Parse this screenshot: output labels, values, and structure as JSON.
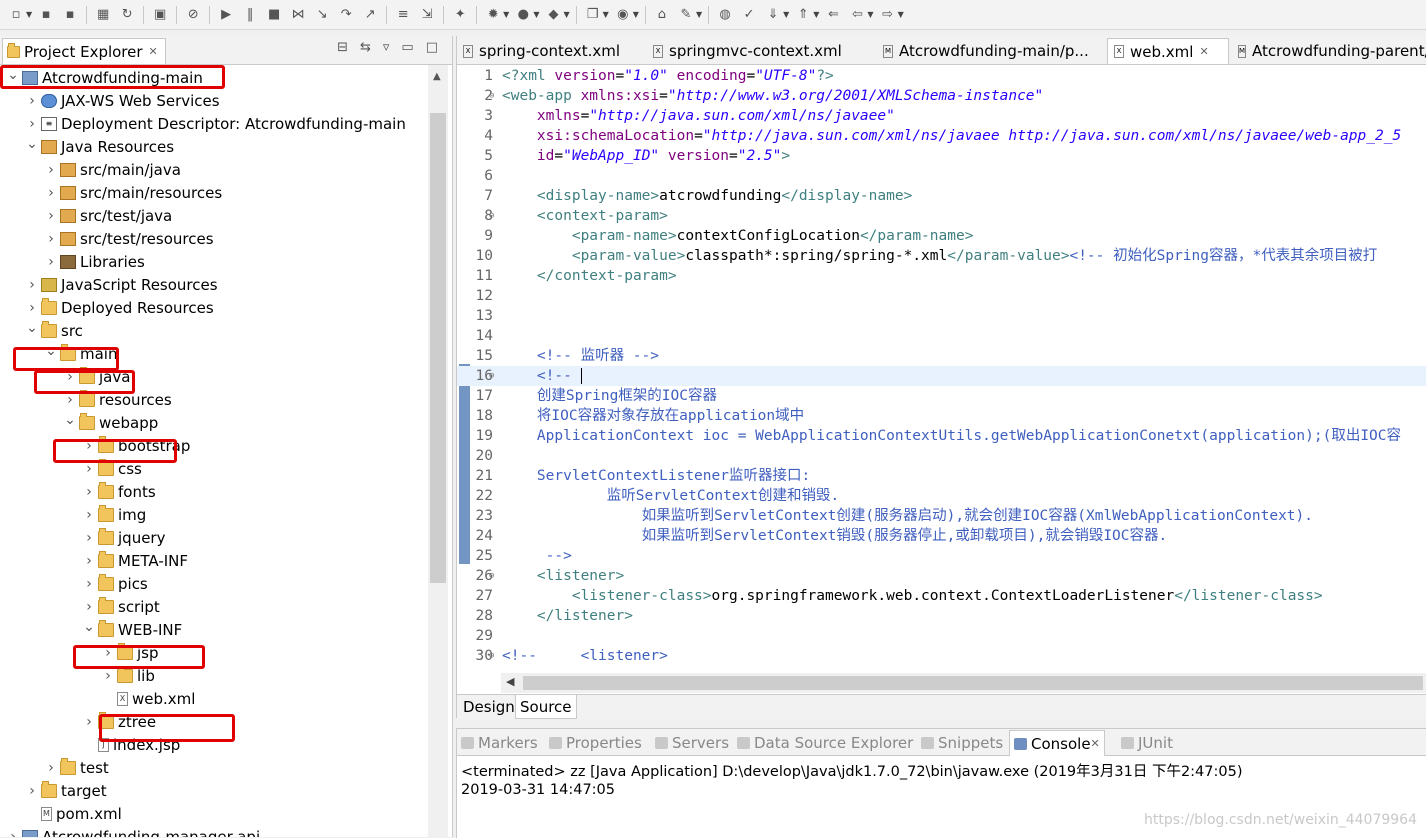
{
  "project_explorer": {
    "tab_label": "Project Explorer",
    "tree": [
      {
        "label": "Atcrowdfunding-main",
        "icon": "project-icon",
        "expanded": true
      },
      {
        "label": "JAX-WS Web Services",
        "icon": "web-services-icon"
      },
      {
        "label": "Deployment Descriptor: Atcrowdfunding-main",
        "icon": "deployment-descriptor-icon"
      },
      {
        "label": "Java Resources",
        "icon": "java-resources-icon",
        "expanded": true
      },
      {
        "label": "src/main/java",
        "icon": "package-folder-icon"
      },
      {
        "label": "src/main/resources",
        "icon": "package-folder-icon"
      },
      {
        "label": "src/test/java",
        "icon": "package-folder-icon"
      },
      {
        "label": "src/test/resources",
        "icon": "package-folder-icon"
      },
      {
        "label": "Libraries",
        "icon": "libraries-icon"
      },
      {
        "label": "JavaScript Resources",
        "icon": "javascript-resources-icon"
      },
      {
        "label": "Deployed Resources",
        "icon": "folder-icon"
      },
      {
        "label": "src",
        "icon": "folder-icon",
        "expanded": true
      },
      {
        "label": "main",
        "icon": "folder-icon",
        "expanded": true
      },
      {
        "label": "java",
        "icon": "folder-icon"
      },
      {
        "label": "resources",
        "icon": "folder-icon"
      },
      {
        "label": "webapp",
        "icon": "folder-icon",
        "expanded": true
      },
      {
        "label": "bootstrap",
        "icon": "folder-icon"
      },
      {
        "label": "css",
        "icon": "folder-icon"
      },
      {
        "label": "fonts",
        "icon": "folder-icon"
      },
      {
        "label": "img",
        "icon": "folder-icon"
      },
      {
        "label": "jquery",
        "icon": "folder-icon"
      },
      {
        "label": "META-INF",
        "icon": "folder-icon"
      },
      {
        "label": "pics",
        "icon": "folder-icon"
      },
      {
        "label": "script",
        "icon": "folder-icon"
      },
      {
        "label": "WEB-INF",
        "icon": "folder-icon",
        "expanded": true
      },
      {
        "label": "jsp",
        "icon": "folder-icon"
      },
      {
        "label": "lib",
        "icon": "folder-icon"
      },
      {
        "label": "web.xml",
        "icon": "xml-file-icon"
      },
      {
        "label": "ztree",
        "icon": "folder-icon"
      },
      {
        "label": "index.jsp",
        "icon": "jsp-file-icon"
      },
      {
        "label": "test",
        "icon": "folder-icon"
      },
      {
        "label": "target",
        "icon": "folder-icon"
      },
      {
        "label": "pom.xml",
        "icon": "maven-file-icon"
      },
      {
        "label": "Atcrowdfunding-manager-api",
        "icon": "project-icon"
      }
    ]
  },
  "editor": {
    "tabs": [
      {
        "label": "spring-context.xml"
      },
      {
        "label": "springmvc-context.xml"
      },
      {
        "label": "Atcrowdfunding-main/p..."
      },
      {
        "label": "web.xml",
        "active": true
      },
      {
        "label": "Atcrowdfunding-parent/..."
      }
    ],
    "lines": [
      [
        [
          "tag",
          "<?xml "
        ],
        [
          "attr",
          "version"
        ],
        [
          "plain",
          "="
        ],
        [
          "val",
          "\"1.0\""
        ],
        [
          "plain",
          " "
        ],
        [
          "attr",
          "encoding"
        ],
        [
          "plain",
          "="
        ],
        [
          "val",
          "\"UTF-8\""
        ],
        [
          "tag",
          "?>"
        ]
      ],
      [
        [
          "tag",
          "<web-app "
        ],
        [
          "attr",
          "xmlns:xsi"
        ],
        [
          "plain",
          "="
        ],
        [
          "val",
          "\"http://www.w3.org/2001/XMLSchema-instance\""
        ]
      ],
      [
        [
          "plain",
          "    "
        ],
        [
          "attr",
          "xmlns"
        ],
        [
          "plain",
          "="
        ],
        [
          "val",
          "\"http://java.sun.com/xml/ns/javaee\""
        ]
      ],
      [
        [
          "plain",
          "    "
        ],
        [
          "attr",
          "xsi:schemaLocation"
        ],
        [
          "plain",
          "="
        ],
        [
          "val",
          "\"http://java.sun.com/xml/ns/javaee http://java.sun.com/xml/ns/javaee/web-app_2_5"
        ]
      ],
      [
        [
          "plain",
          "    "
        ],
        [
          "attr",
          "id"
        ],
        [
          "plain",
          "="
        ],
        [
          "val",
          "\"WebApp_ID\""
        ],
        [
          "plain",
          " "
        ],
        [
          "attr",
          "version"
        ],
        [
          "plain",
          "="
        ],
        [
          "val",
          "\"2.5\""
        ],
        [
          "tag",
          ">"
        ]
      ],
      [],
      [
        [
          "plain",
          "    "
        ],
        [
          "tag",
          "<display-name>"
        ],
        [
          "plain",
          "atcrowdfunding"
        ],
        [
          "tag",
          "</display-name>"
        ]
      ],
      [
        [
          "plain",
          "    "
        ],
        [
          "tag",
          "<context-param>"
        ]
      ],
      [
        [
          "plain",
          "        "
        ],
        [
          "tag",
          "<param-name>"
        ],
        [
          "plain",
          "contextConfigLocation"
        ],
        [
          "tag",
          "</param-name>"
        ]
      ],
      [
        [
          "plain",
          "        "
        ],
        [
          "tag",
          "<param-value>"
        ],
        [
          "plain",
          "classpath*:spring/spring-*.xml"
        ],
        [
          "tag",
          "</param-value>"
        ],
        [
          "com",
          "<!-- 初始化Spring容器，*代表其余项目被打"
        ]
      ],
      [
        [
          "plain",
          "    "
        ],
        [
          "tag",
          "</context-param>"
        ]
      ],
      [],
      [],
      [],
      [
        [
          "plain",
          "    "
        ],
        [
          "com",
          "<!-- 监听器 -->"
        ]
      ],
      [
        [
          "plain",
          "    "
        ],
        [
          "com",
          "<!-- "
        ]
      ],
      [
        [
          "plain",
          "    "
        ],
        [
          "com",
          "创建Spring框架的IOC容器"
        ]
      ],
      [
        [
          "plain",
          "    "
        ],
        [
          "com",
          "将IOC容器对象存放在application域中"
        ]
      ],
      [
        [
          "plain",
          "    "
        ],
        [
          "com",
          "ApplicationContext ioc = WebApplicationContextUtils.getWebApplicationConetxt(application);(取出IOC容"
        ]
      ],
      [],
      [
        [
          "plain",
          "    "
        ],
        [
          "com",
          "ServletContextListener监听器接口:"
        ]
      ],
      [
        [
          "plain",
          "            "
        ],
        [
          "com",
          "监听ServletContext创建和销毁."
        ]
      ],
      [
        [
          "plain",
          "                "
        ],
        [
          "com",
          "如果监听到ServletContext创建(服务器启动),就会创建IOC容器(XmlWebApplicationContext)."
        ]
      ],
      [
        [
          "plain",
          "                "
        ],
        [
          "com",
          "如果监听到ServletContext销毁(服务器停止,或卸载项目),就会销毁IOC容器."
        ]
      ],
      [
        [
          "plain",
          "     "
        ],
        [
          "com",
          "-->"
        ]
      ],
      [
        [
          "plain",
          "    "
        ],
        [
          "tag",
          "<listener>"
        ]
      ],
      [
        [
          "plain",
          "        "
        ],
        [
          "tag",
          "<listener-class>"
        ],
        [
          "plain",
          "org.springframework.web.context.ContextLoaderListener"
        ],
        [
          "tag",
          "</listener-class>"
        ]
      ],
      [
        [
          "plain",
          "    "
        ],
        [
          "tag",
          "</listener>"
        ]
      ],
      [],
      [
        [
          "com",
          "<!--     <listener>"
        ]
      ]
    ],
    "fold_lines": [
      2,
      8,
      16,
      26,
      30
    ],
    "current_line": 16,
    "bottom_tabs": [
      {
        "label": "Design"
      },
      {
        "label": "Source",
        "active": true
      }
    ]
  },
  "bottom_panel": {
    "tabs": [
      {
        "label": "Markers"
      },
      {
        "label": "Properties"
      },
      {
        "label": "Servers"
      },
      {
        "label": "Data Source Explorer"
      },
      {
        "label": "Snippets"
      },
      {
        "label": "Console",
        "active": true
      },
      {
        "label": "JUnit"
      }
    ],
    "console_header": "<terminated> zz [Java Application] D:\\develop\\Java\\jdk1.7.0_72\\bin\\javaw.exe (2019年3月31日 下午2:47:05)",
    "console_output": "2019-03-31 14:47:05",
    "watermark": "https://blog.csdn.net/weixin_44079964"
  },
  "colors": {
    "highlight": "#e00000",
    "gutter_change": "#7295c4"
  }
}
